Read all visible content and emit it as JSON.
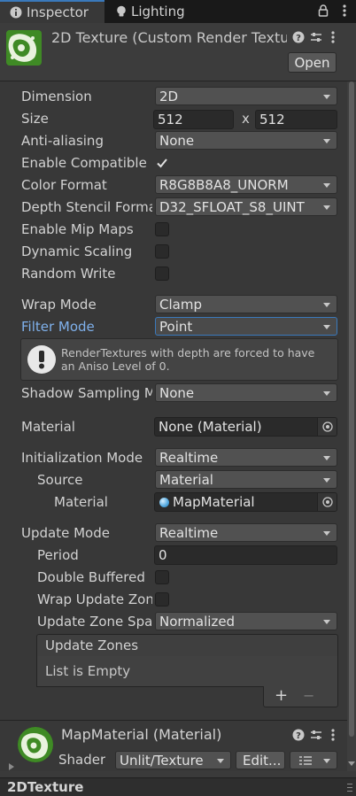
{
  "tabs": [
    {
      "label": "Inspector",
      "active": true,
      "icon": "info-icon"
    },
    {
      "label": "Lighting",
      "active": false,
      "icon": "lightbulb-icon"
    }
  ],
  "header": {
    "title": "2D Texture (Custom Render Textu",
    "open_label": "Open"
  },
  "fields": {
    "dimension": {
      "label": "Dimension",
      "value": "2D"
    },
    "size": {
      "label": "Size",
      "width": "512",
      "sep": "x",
      "height": "512"
    },
    "anti_aliasing": {
      "label": "Anti-aliasing",
      "value": "None"
    },
    "enable_compatible": {
      "label": "Enable Compatible F",
      "checked": true
    },
    "color_format": {
      "label": "Color Format",
      "value": "R8G8B8A8_UNORM"
    },
    "depth_stencil": {
      "label": "Depth Stencil Format",
      "value": "D32_SFLOAT_S8_UINT"
    },
    "mip_maps": {
      "label": "Enable Mip Maps",
      "checked": false
    },
    "dynamic_scaling": {
      "label": "Dynamic Scaling",
      "checked": false
    },
    "random_write": {
      "label": "Random Write",
      "checked": false
    },
    "wrap_mode": {
      "label": "Wrap Mode",
      "value": "Clamp"
    },
    "filter_mode": {
      "label": "Filter Mode",
      "value": "Point"
    },
    "help": "RenderTextures with depth are forced to have an Aniso Level of 0.",
    "shadow_sampling": {
      "label": "Shadow Sampling M",
      "value": "None"
    },
    "material": {
      "label": "Material",
      "value": "None (Material)"
    },
    "init_mode": {
      "label": "Initialization Mode",
      "value": "Realtime"
    },
    "source": {
      "label": "Source",
      "value": "Material"
    },
    "source_material": {
      "label": "Material",
      "value": "MapMaterial"
    },
    "update_mode": {
      "label": "Update Mode",
      "value": "Realtime"
    },
    "period": {
      "label": "Period",
      "value": "0"
    },
    "double_buffered": {
      "label": "Double Buffered",
      "checked": false
    },
    "wrap_update_zone": {
      "label": "Wrap Update Zone",
      "checked": false
    },
    "update_zone_space": {
      "label": "Update Zone Spac",
      "value": "Normalized"
    },
    "update_zones": {
      "header": "Update Zones",
      "empty": "List is Empty",
      "add": "+",
      "remove": "−"
    }
  },
  "material_section": {
    "title": "MapMaterial (Material)",
    "shader_label": "Shader",
    "shader_value": "Unlit/Texture",
    "edit_label": "Edit..."
  },
  "footer": {
    "label": "2DTexture"
  },
  "colors": {
    "accent": "#3a79bb",
    "highlight_label": "#7fb1ec",
    "background": "#383838"
  }
}
